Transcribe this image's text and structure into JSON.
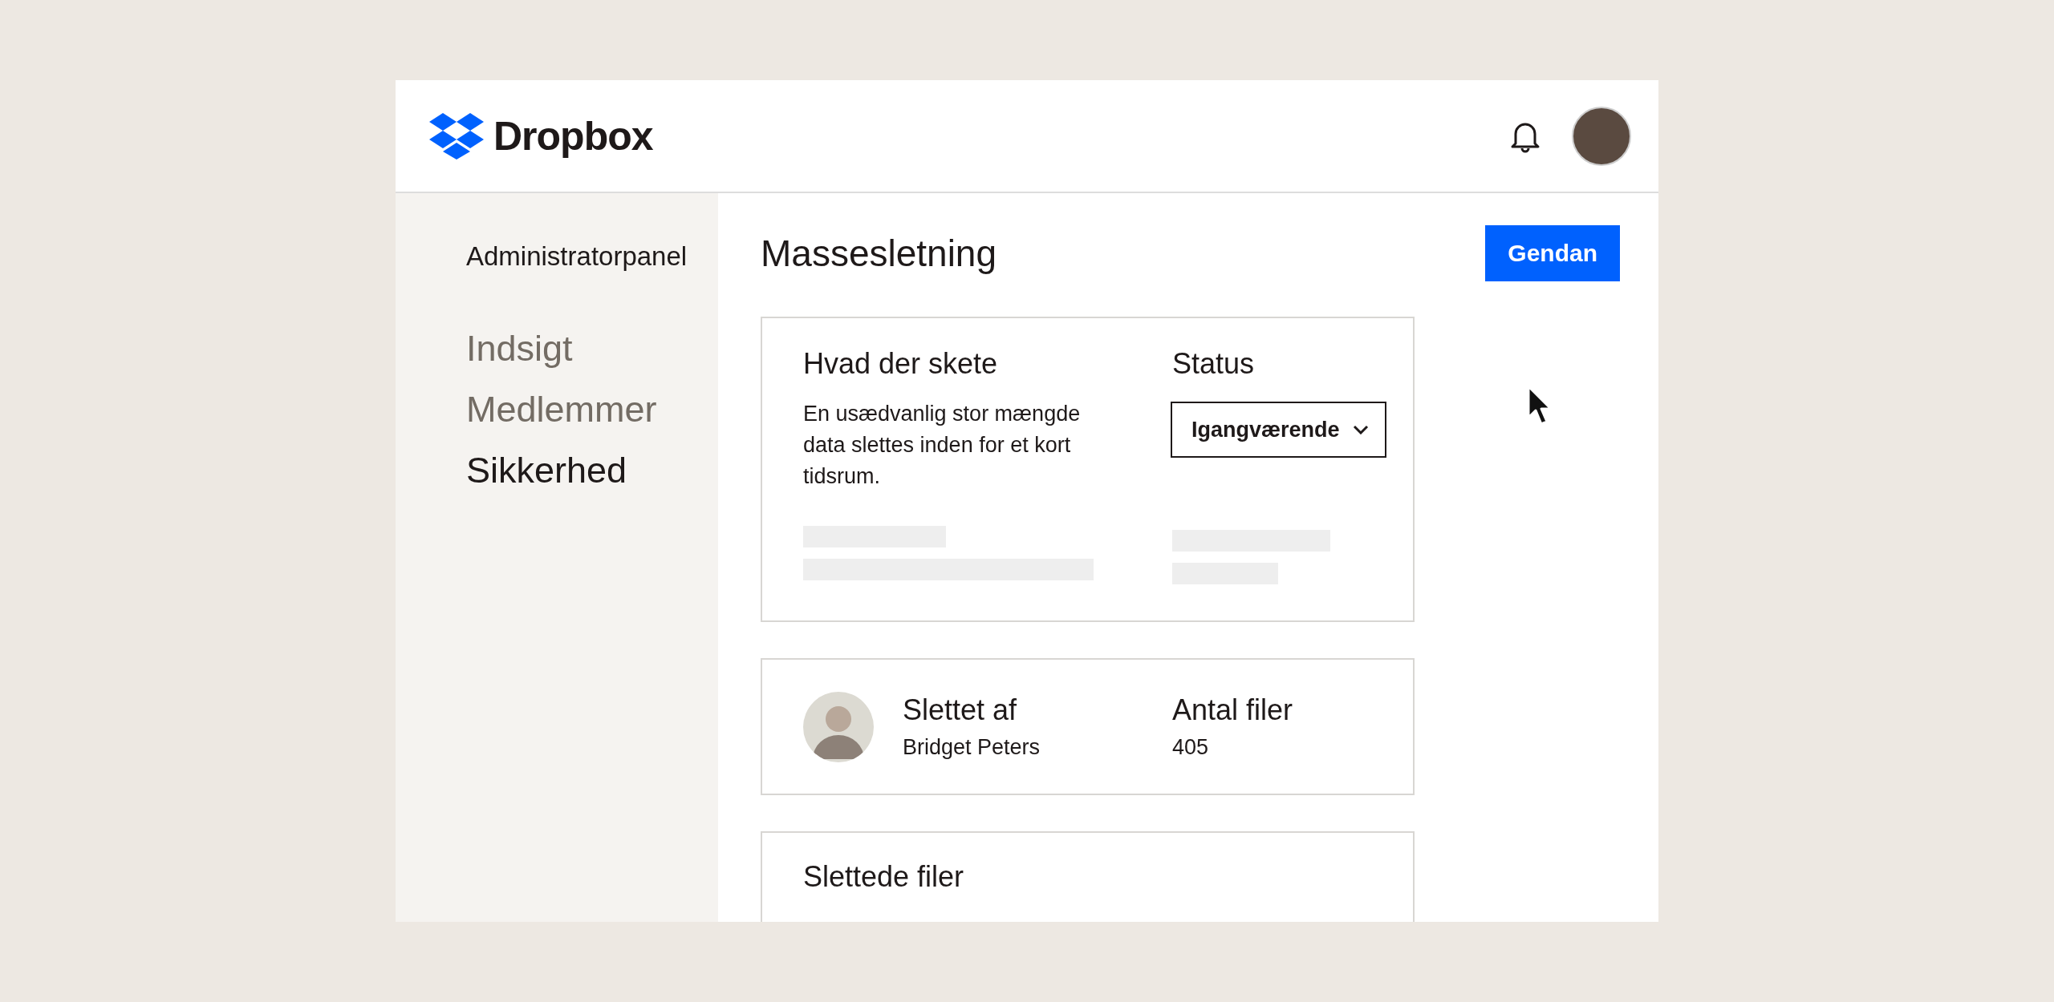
{
  "header": {
    "logo_text": "Dropbox"
  },
  "sidebar": {
    "title": "Administratorpanel",
    "items": [
      {
        "label": "Indsigt",
        "selected": false
      },
      {
        "label": "Medlemmer",
        "selected": false
      },
      {
        "label": "Sikkerhed",
        "selected": true
      }
    ]
  },
  "main": {
    "title": "Massesletning",
    "restore_button": "Gendan",
    "event_card": {
      "heading": "Hvad der skete",
      "description": "En usædvanlig stor mængde data slettes inden for et kort tidsrum.",
      "status_heading": "Status",
      "status_dropdown": "Igangværende"
    },
    "deleted_by_card": {
      "heading": "Slettet af",
      "name": "Bridget Peters",
      "count_heading": "Antal filer",
      "count": "405"
    },
    "files_card": {
      "heading": "Slettede filer"
    }
  }
}
